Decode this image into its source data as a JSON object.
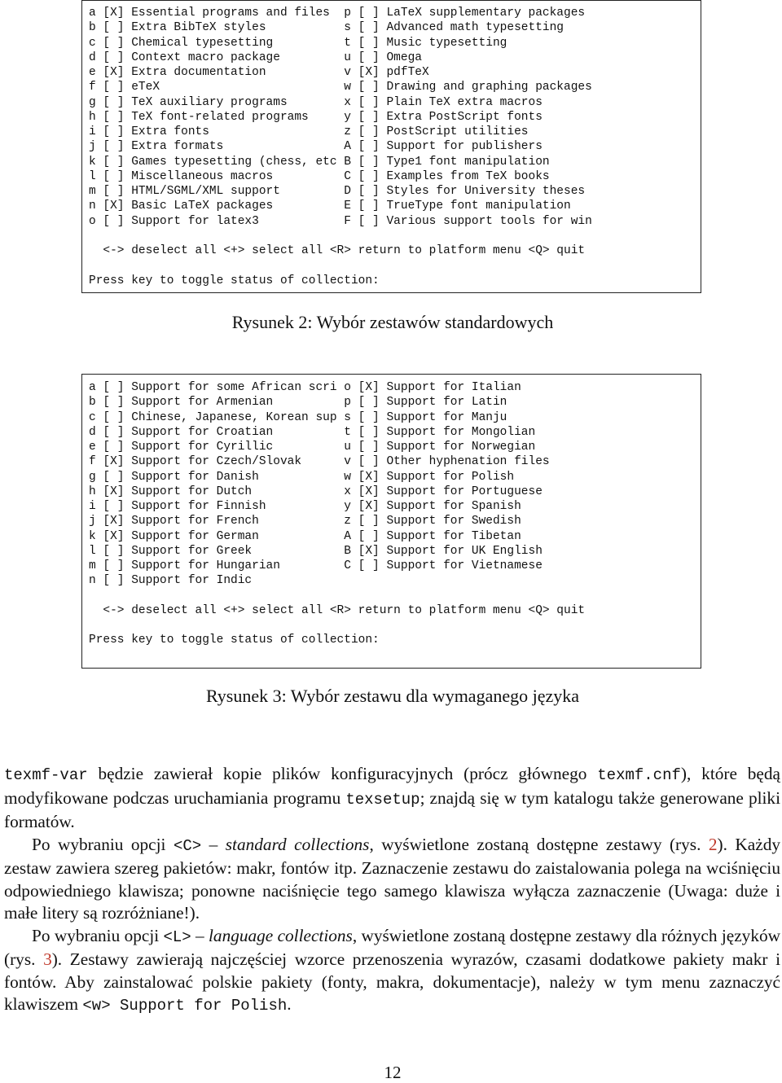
{
  "figure2": {
    "rows": [
      "a [X] Essential programs and files  p [ ] LaTeX supplementary packages",
      "b [ ] Extra BibTeX styles           s [ ] Advanced math typesetting",
      "c [ ] Chemical typesetting          t [ ] Music typesetting",
      "d [ ] Context macro package         u [ ] Omega",
      "e [X] Extra documentation           v [X] pdfTeX",
      "f [ ] eTeX                          w [ ] Drawing and graphing packages",
      "g [ ] TeX auxiliary programs        x [ ] Plain TeX extra macros",
      "h [ ] TeX font-related programs     y [ ] Extra PostScript fonts",
      "i [ ] Extra fonts                   z [ ] PostScript utilities",
      "j [ ] Extra formats                 A [ ] Support for publishers",
      "k [ ] Games typesetting (chess, etc B [ ] Type1 font manipulation",
      "l [ ] Miscellaneous macros          C [ ] Examples from TeX books",
      "m [ ] HTML/SGML/XML support         D [ ] Styles for University theses",
      "n [X] Basic LaTeX packages          E [ ] TrueType font manipulation",
      "o [ ] Support for latex3            F [ ] Various support tools for win"
    ],
    "menu": "  <-> deselect all <+> select all <R> return to platform menu <Q> quit",
    "prompt": "Press key to toggle status of collection:",
    "caption": "Rysunek 2: Wybór zestawów standardowych"
  },
  "figure3": {
    "rows": [
      "a [ ] Support for some African scri o [X] Support for Italian",
      "b [ ] Support for Armenian          p [ ] Support for Latin",
      "c [ ] Chinese, Japanese, Korean sup s [ ] Support for Manju",
      "d [ ] Support for Croatian          t [ ] Support for Mongolian",
      "e [ ] Support for Cyrillic          u [ ] Support for Norwegian",
      "f [X] Support for Czech/Slovak      v [ ] Other hyphenation files",
      "g [ ] Support for Danish            w [X] Support for Polish",
      "h [X] Support for Dutch             x [X] Support for Portuguese",
      "i [ ] Support for Finnish           y [X] Support for Spanish",
      "j [X] Support for French            z [ ] Support for Swedish",
      "k [X] Support for German            A [ ] Support for Tibetan",
      "l [ ] Support for Greek             B [X] Support for UK English",
      "m [ ] Support for Hungarian         C [ ] Support for Vietnamese",
      "n [ ] Support for Indic"
    ],
    "menu": "  <-> deselect all <+> select all <R> return to platform menu <Q> quit",
    "prompt": "Press key to toggle status of collection:",
    "caption": "Rysunek 3: Wybór zestawu dla wymaganego języka"
  },
  "body": {
    "p1": [
      "texmf-var",
      " będzie zawierał kopie plików konfiguracyjnych (prócz głównego ",
      "texmf.cnf",
      "), które będą modyfikowane podczas uruchamiania programu ",
      "texsetup",
      "; znajdą się w tym katalogu także generowane pliki formatów."
    ],
    "p2": [
      "Po wybraniu opcji ",
      "<C>",
      " – ",
      "standard collections",
      ", wyświetlone zostaną dostępne zestawy (rys. ",
      "2",
      "). Każdy zestaw zawiera szereg pakietów: makr, fontów itp. Zaznaczenie zestawu do zaistalowania polega na wciśnięciu odpowiedniego klawisza; ponowne naciśnięcie tego samego klawisza wyłącza zaznaczenie (Uwaga: duże i małe litery są rozróżniane!)."
    ],
    "p3": [
      "Po wybraniu opcji ",
      "<L>",
      " – ",
      "language collections",
      ", wyświetlone zostaną dostępne zestawy dla różnych języków (rys. ",
      "3",
      "). Zestawy zawierają najczęściej wzorce przenoszenia wyrazów, czasami dodatkowe pakiety makr i fontów. Aby zainstalować polskie pakiety (fonty, makra, dokumentacje), należy w tym menu zaznaczyć klawiszem ",
      "<w> Support for Polish",
      "."
    ]
  },
  "page_number": "12",
  "colors": {
    "reference": "#c0392b"
  }
}
